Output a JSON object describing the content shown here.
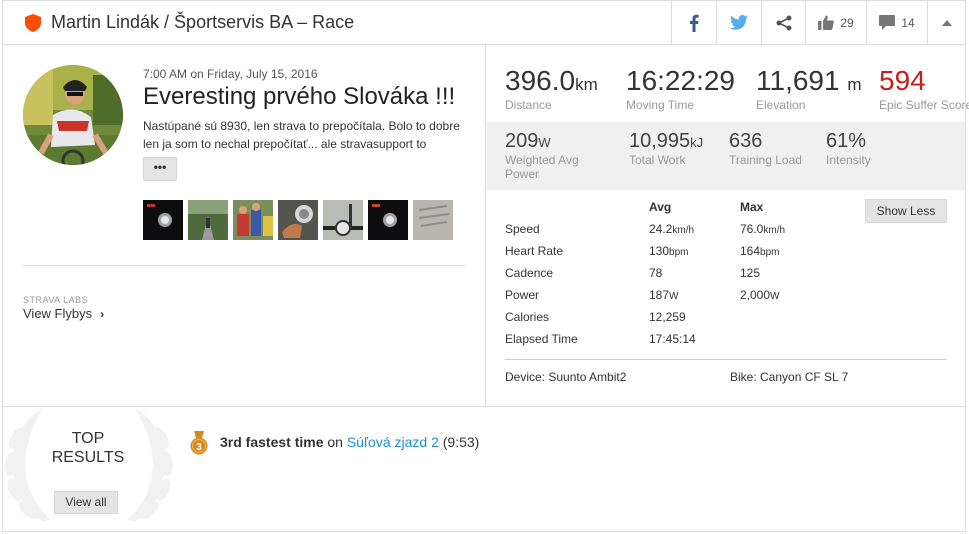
{
  "header": {
    "title": "Martin Lindák / Športservis BA – Race",
    "likes": "29",
    "comments": "14"
  },
  "activity": {
    "date": "7:00 AM on Friday, July 15, 2016",
    "title": "Everesting prvého Slováka !!!",
    "description_line1": "Nastúpané sú 8930, len strava to prepočítala. Bolo to dobre",
    "description_line2": "len ja som to nechal prepočítať... ale stravasupport to",
    "more_label": "•••"
  },
  "labs": {
    "label": "STRAVA LABS",
    "flybys": "View Flybys"
  },
  "summary": [
    {
      "value": "396.0",
      "unit": "km",
      "label": "Distance"
    },
    {
      "value": "16:22:29",
      "unit": "",
      "label": "Moving Time"
    },
    {
      "value": "11,691",
      "unit": "m",
      "label": "Elevation"
    },
    {
      "value": "594",
      "unit": "",
      "label": "Epic Suffer Score"
    }
  ],
  "secondary": [
    {
      "value": "209",
      "unit": "W",
      "label": "Weighted Avg Power"
    },
    {
      "value": "10,995",
      "unit": "kJ",
      "label": "Total Work"
    },
    {
      "value": "636",
      "unit": "",
      "label": "Training Load"
    },
    {
      "value": "61%",
      "unit": "",
      "label": "Intensity"
    }
  ],
  "stats_table": {
    "col_avg": "Avg",
    "col_max": "Max",
    "rows": [
      {
        "label": "Speed",
        "avg": "24.2",
        "avg_unit": "km/h",
        "max": "76.0",
        "max_unit": "km/h"
      },
      {
        "label": "Heart Rate",
        "avg": "130",
        "avg_unit": "bpm",
        "max": "164",
        "max_unit": "bpm"
      },
      {
        "label": "Cadence",
        "avg": "78",
        "avg_unit": "",
        "max": "125",
        "max_unit": ""
      },
      {
        "label": "Power",
        "avg": "187",
        "avg_unit": "W",
        "max": "2,000",
        "max_unit": "W"
      },
      {
        "label": "Calories",
        "avg": "12,259",
        "avg_unit": "",
        "max": "",
        "max_unit": ""
      },
      {
        "label": "Elapsed Time",
        "avg": "17:45:14",
        "avg_unit": "",
        "max": "",
        "max_unit": ""
      }
    ],
    "show_less": "Show Less"
  },
  "device": "Device: Suunto Ambit2",
  "bike": "Bike: Canyon CF SL 7",
  "top_results": {
    "line1": "TOP",
    "line2": "RESULTS",
    "view_all": "View all",
    "medal_rank": "3",
    "achievement": "3rd fastest time",
    "on_word": "on",
    "segment": "Súľová zjazd 2",
    "time": "(9:53)"
  },
  "colors": {
    "brand_orange": "#fc4c02",
    "suffer_red": "#c1201f",
    "link_blue": "#1a8fc9",
    "facebook_blue": "#3b5998",
    "twitter_blue": "#55acee",
    "bronze": "#d38a1e"
  }
}
